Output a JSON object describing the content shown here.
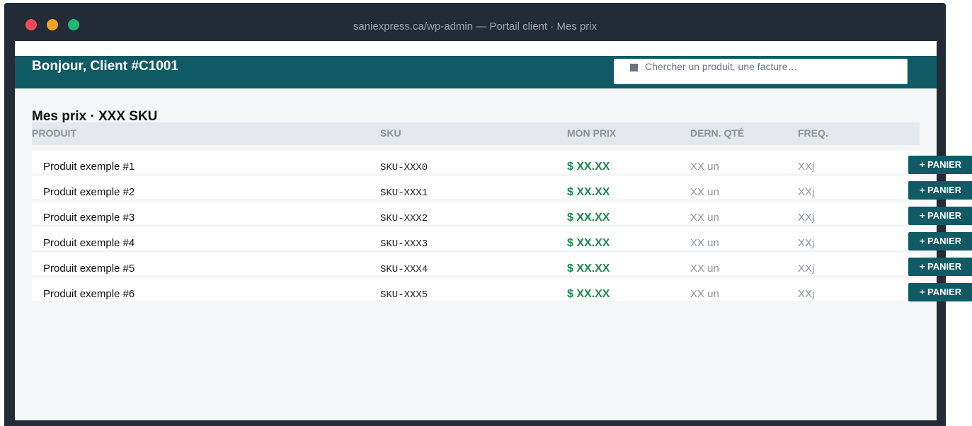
{
  "window": {
    "title": "saniexpress.ca/wp-admin — Portail client · Mes prix"
  },
  "header": {
    "greeting": "Bonjour, Client #C1001",
    "search_placeholder": "Chercher un produit, une facture…"
  },
  "section": {
    "title": "Mes prix  ·  XXX SKU"
  },
  "table": {
    "columns": [
      "PRODUIT",
      "SKU",
      "MON PRIX",
      "DERN. QTÉ",
      "FREQ."
    ],
    "add_label": "+ PANIER",
    "rows": [
      {
        "product": "Produit exemple #1",
        "sku": "SKU-XXX0",
        "price": "$ XX.XX",
        "qty": "XX un",
        "freq": "XXj"
      },
      {
        "product": "Produit exemple #2",
        "sku": "SKU-XXX1",
        "price": "$ XX.XX",
        "qty": "XX un",
        "freq": "XXj"
      },
      {
        "product": "Produit exemple #3",
        "sku": "SKU-XXX2",
        "price": "$ XX.XX",
        "qty": "XX un",
        "freq": "XXj"
      },
      {
        "product": "Produit exemple #4",
        "sku": "SKU-XXX3",
        "price": "$ XX.XX",
        "qty": "XX un",
        "freq": "XXj"
      },
      {
        "product": "Produit exemple #5",
        "sku": "SKU-XXX4",
        "price": "$ XX.XX",
        "qty": "XX un",
        "freq": "XXj"
      },
      {
        "product": "Produit exemple #6",
        "sku": "SKU-XXX5",
        "price": "$ XX.XX",
        "qty": "XX un",
        "freq": "XXj"
      }
    ]
  },
  "colors": {
    "brand": "#0f5a64",
    "price": "#1a8a4c",
    "chrome": "#222b36"
  }
}
